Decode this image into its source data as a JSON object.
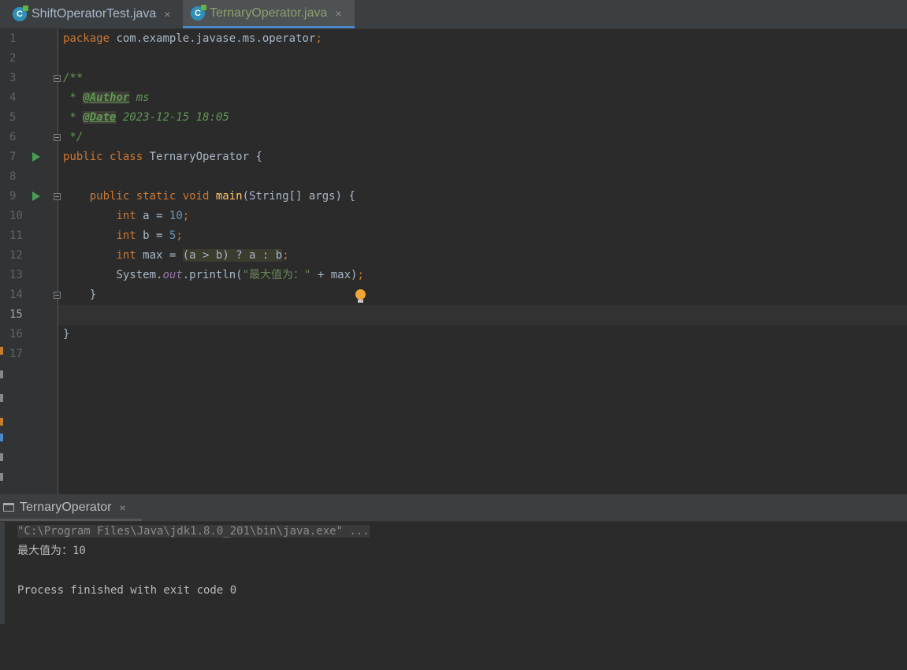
{
  "tabs": [
    {
      "label": "ShiftOperatorTest.java",
      "icon": "java-class-icon",
      "active": false
    },
    {
      "label": "TernaryOperator.java",
      "icon": "java-class-icon",
      "active": true
    }
  ],
  "close_glyph": "×",
  "editor": {
    "line_numbers": [
      "1",
      "2",
      "3",
      "4",
      "5",
      "6",
      "7",
      "8",
      "9",
      "10",
      "11",
      "12",
      "13",
      "14",
      "15",
      "16",
      "17"
    ],
    "current_line": "15",
    "code": {
      "l1_kw": "package",
      "l1_rest": " com.example.javase.ms.operator",
      "l1_semi": ";",
      "l3": "/**",
      "l4_star": " * ",
      "l4_tag": "@Author",
      "l4_val": " ms",
      "l5_star": " * ",
      "l5_tag": "@Date",
      "l5_val": " 2023-12-15 18:05",
      "l6": " */",
      "l7_kw": "public class",
      "l7_rest": " TernaryOperator {",
      "l9_indent": "    ",
      "l9_kw": "public static void",
      "l9_sp": " ",
      "l9_fn": "main",
      "l9_rest": "(String[] args) {",
      "l10_indent": "        ",
      "l10_kw": "int",
      "l10_mid": " a = ",
      "l10_num": "10",
      "l10_semi": ";",
      "l11_indent": "        ",
      "l11_kw": "int",
      "l11_mid": " b = ",
      "l11_num": "5",
      "l11_semi": ";",
      "l12_indent": "        ",
      "l12_kw": "int",
      "l12_mid": " max = ",
      "l12_hl": "(a > b) ? a : b",
      "l12_semi": ";",
      "l13_indent": "        ",
      "l13_a": "System.",
      "l13_field": "out",
      "l13_b": ".println(",
      "l13_str": "\"最大值为：\"",
      "l13_c": " + max)",
      "l13_semi": ";",
      "l14": "    }",
      "l16": "}"
    }
  },
  "run_panel": {
    "tab_label": "TernaryOperator",
    "command": "\"C:\\Program Files\\Java\\jdk1.8.0_201\\bin\\java.exe\" ...",
    "output": "最大值为：10",
    "exit_message": "Process finished with exit code 0"
  },
  "colors": {
    "background": "#2b2b2b",
    "keyword": "#cc7832",
    "number": "#6897bb",
    "string": "#6a8759",
    "doc": "#629755",
    "function": "#ffc66d",
    "active_tab_underline": "#4a88c7"
  }
}
